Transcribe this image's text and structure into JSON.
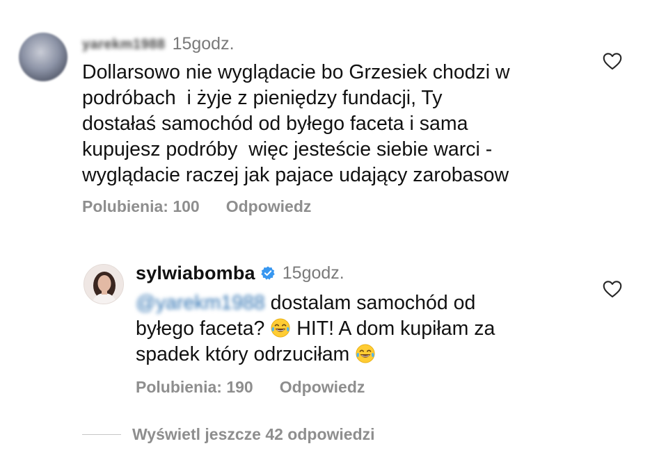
{
  "comments": [
    {
      "username": "yarekm1988",
      "time": "15godz.",
      "text": "Dollarsowo nie wyglądacie bo Grzesiek chodzi w\npodróbach  i żyje z pieniędzy fundacji, Ty\ndostałaś samochód od byłego faceta i sama\nkupujesz podróby  więc jesteście siebie warci -\nwyglądacie raczej jak pajace udający zarobasow",
      "likes": "Polubienia: 100",
      "reply": "Odpowiedz"
    },
    {
      "username": "sylwiabomba",
      "verified": true,
      "time": "15godz.",
      "mention": "@yarekm1988",
      "text_a": " dostalam samochód od\nbyłego faceta? ",
      "text_b": " HIT! A dom kupiłam za\nspadek który odrzuciłam ",
      "likes": "Polubienia: 190",
      "reply": "Odpowiedz"
    }
  ],
  "view_more": "Wyświetl jeszcze 42 odpowiedzi",
  "icons": {
    "heart": "heart-outline-icon",
    "verified": "verified-badge-icon",
    "emoji": "face-with-tears-of-joy-emoji"
  },
  "colors": {
    "text": "#111111",
    "secondary": "#8e8e8e",
    "verified": "#3897f0"
  }
}
